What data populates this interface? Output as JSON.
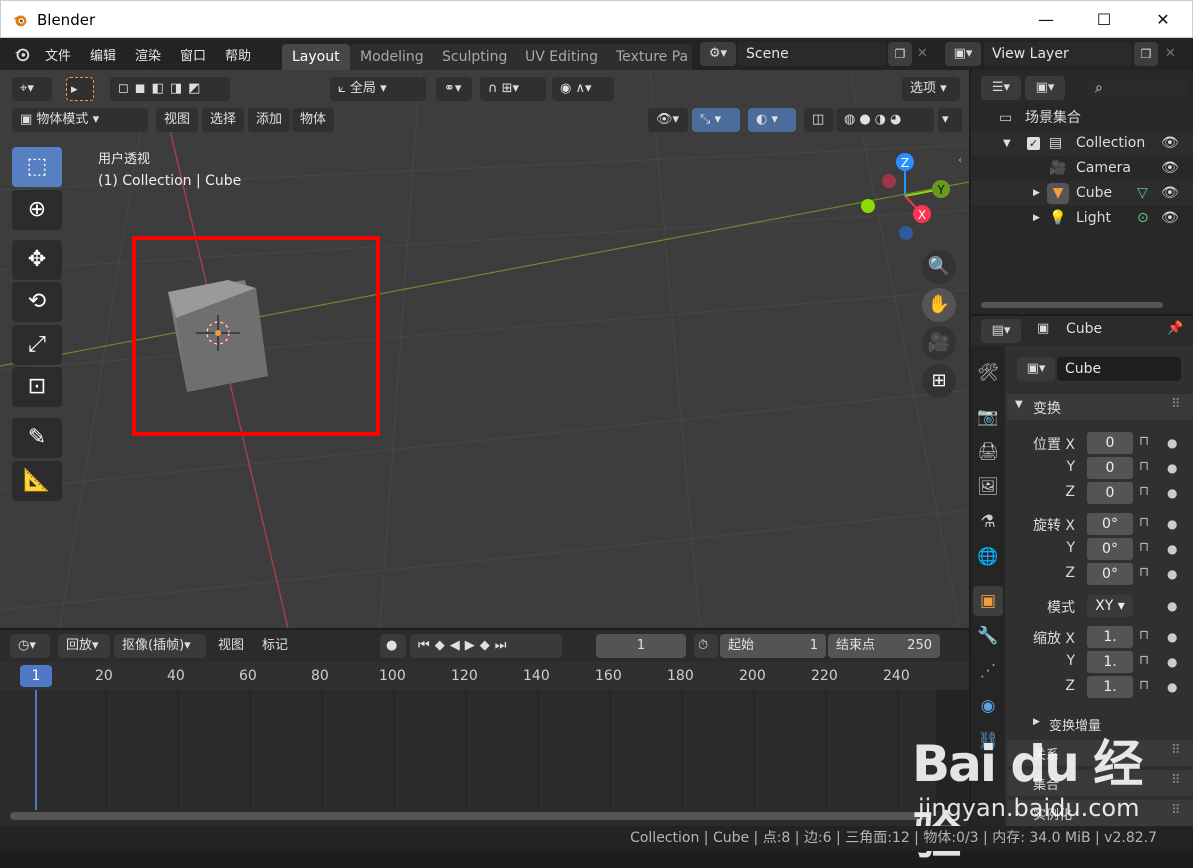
{
  "window": {
    "title": "Blender",
    "minimize": "—",
    "maximize": "☐",
    "close": "✕"
  },
  "menubar": {
    "items": [
      "文件",
      "编辑",
      "渲染",
      "窗口",
      "帮助"
    ]
  },
  "workspaces": [
    "Layout",
    "Modeling",
    "Sculpting",
    "UV Editing",
    "Texture Pa"
  ],
  "scene": {
    "name": "Scene"
  },
  "view_layer": {
    "name": "View Layer"
  },
  "viewport": {
    "transform_orientation": "全局",
    "options": "选项",
    "mode": "物体模式",
    "menus": [
      "视图",
      "选择",
      "添加",
      "物体"
    ],
    "overlay_title": "用户透视",
    "overlay_subtitle": "(1) Collection | Cube",
    "gizmo": {
      "z": "Z",
      "y": "Y",
      "x": "X"
    }
  },
  "timeline": {
    "menus": [
      "回放",
      "抠像(插帧)",
      "视图",
      "标记"
    ],
    "current_frame": "1",
    "start_label": "起始",
    "start_value": "1",
    "end_label": "结束点",
    "end_value": "250",
    "ruler": [
      "1",
      "20",
      "40",
      "60",
      "80",
      "100",
      "120",
      "140",
      "160",
      "180",
      "200",
      "220",
      "240"
    ]
  },
  "outliner": {
    "root": "场景集合",
    "items": [
      {
        "name": "Collection"
      },
      {
        "name": "Camera"
      },
      {
        "name": "Cube"
      },
      {
        "name": "Light"
      }
    ]
  },
  "properties": {
    "header": "Cube",
    "object_name": "Cube",
    "panel_transform": "变换",
    "location_label": "位置 X",
    "rotation_label": "旋转 X",
    "scale_label": "缩放 X",
    "axis_y": "Y",
    "axis_z": "Z",
    "location": [
      "0",
      "0",
      "0"
    ],
    "rotation": [
      "0°",
      "0°",
      "0°"
    ],
    "mode_label": "模式",
    "mode_value": "XY",
    "scale": [
      "1.",
      "1.",
      "1."
    ],
    "delta": "变换增量",
    "relations": "关系",
    "collections": "集合",
    "instancing": "实例化"
  },
  "status": {
    "text": "Collection | Cube | 点:8 | 边:6 | 三角面:12 | 物体:0/3 | 内存: 34.0 MiB | v2.82.7"
  },
  "watermark": {
    "brand": "Bai du 经验",
    "url": "jingyan.baidu.com"
  },
  "colors": {
    "accent": "#5680c2",
    "highlight_box": "#ff0000",
    "x_axis": "#ff3352",
    "y_axis": "#8bdc00",
    "z_axis": "#2890ff",
    "object_orange": "#f29c3c"
  }
}
